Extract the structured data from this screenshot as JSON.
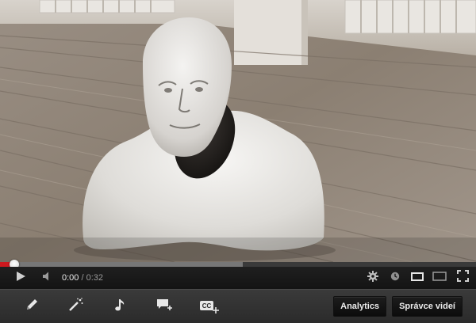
{
  "player": {
    "time_current": "0:00",
    "time_separator": "/",
    "time_duration": "0:32",
    "progress": {
      "played_fraction": 0.03,
      "loaded_fraction": 0.51
    },
    "controls_icons": [
      "play-icon",
      "volume-icon",
      "gear-icon",
      "watch-later-icon",
      "small-player-icon",
      "large-player-icon",
      "fullscreen-icon"
    ]
  },
  "editor_toolbar": {
    "tools_icons": [
      "pencil-icon",
      "magic-wand-icon",
      "music-note-icon",
      "add-annotation-icon",
      "add-captions-icon"
    ],
    "captions_badge": "CC",
    "analytics_label": "Analytics",
    "video_manager_label": "Správce videí"
  },
  "colors": {
    "accent_red": "#cc181e",
    "controls_bg": "#1b1b1b",
    "toolbar_bg": "#333333"
  }
}
